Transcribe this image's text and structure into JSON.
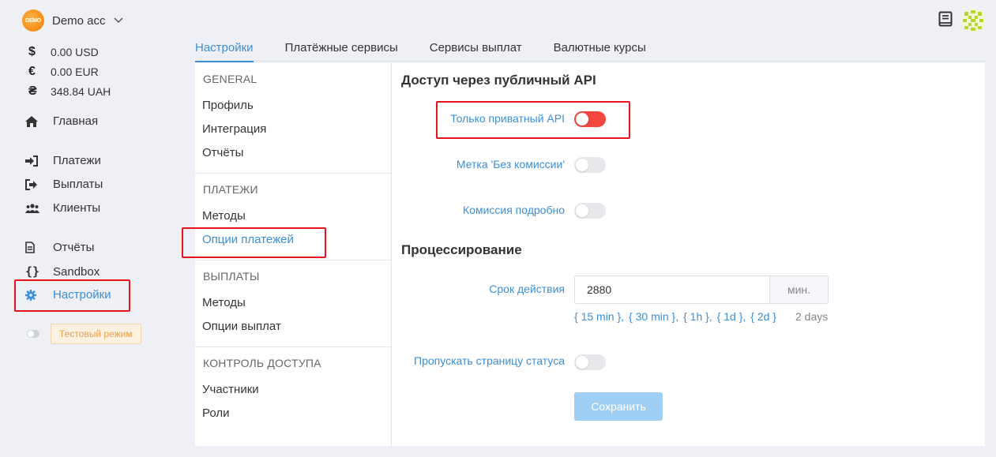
{
  "account": {
    "logo_text": "DEMO",
    "name": "Demo acc"
  },
  "balances": [
    {
      "symbol": "$",
      "amount": "0.00 USD"
    },
    {
      "symbol": "€",
      "amount": "0.00 EUR"
    },
    {
      "symbol": "₴",
      "amount": "348.84 UAH"
    }
  ],
  "nav": {
    "home": "Главная",
    "payments": "Платежи",
    "payouts": "Выплаты",
    "clients": "Клиенты",
    "reports": "Отчёты",
    "sandbox": "Sandbox",
    "settings": "Настройки"
  },
  "test_mode": {
    "label": "Тестовый режим",
    "enabled": false
  },
  "tabs": [
    "Настройки",
    "Платёжные сервисы",
    "Сервисы выплат",
    "Валютные курсы"
  ],
  "subnav": {
    "general": {
      "heading": "GENERAL",
      "items": [
        "Профиль",
        "Интеграция",
        "Отчёты"
      ]
    },
    "payments": {
      "heading": "ПЛАТЕЖИ",
      "items": [
        "Методы",
        "Опции платежей"
      ]
    },
    "payouts": {
      "heading": "ВЫПЛАТЫ",
      "items": [
        "Методы",
        "Опции выплат"
      ]
    },
    "access": {
      "heading": "КОНТРОЛЬ ДОСТУПА",
      "items": [
        "Участники",
        "Роли"
      ]
    }
  },
  "content": {
    "api_section": "Доступ через публичный API",
    "private_api_label": "Только приватный API",
    "private_api_on": true,
    "no_fee_label": "Метка 'Без комиссии'",
    "no_fee_on": false,
    "fee_details_label": "Комиссия подробно",
    "fee_details_on": false,
    "processing_section": "Процессирование",
    "expiry_label": "Срок действия",
    "expiry_value": "2880",
    "expiry_unit": "мин.",
    "presets": [
      "{ 15 min },",
      "{ 30 min },",
      "{ 1h },",
      "{ 1d },",
      "{ 2d }"
    ],
    "expiry_hint": "2 days",
    "skip_status_label": "Пропускать страницу статуса",
    "skip_status_on": false,
    "save_label": "Сохранить"
  },
  "colors": {
    "accent": "#3b8fd6",
    "highlight": "#e8141c",
    "toggle_on": "#f2473f"
  }
}
